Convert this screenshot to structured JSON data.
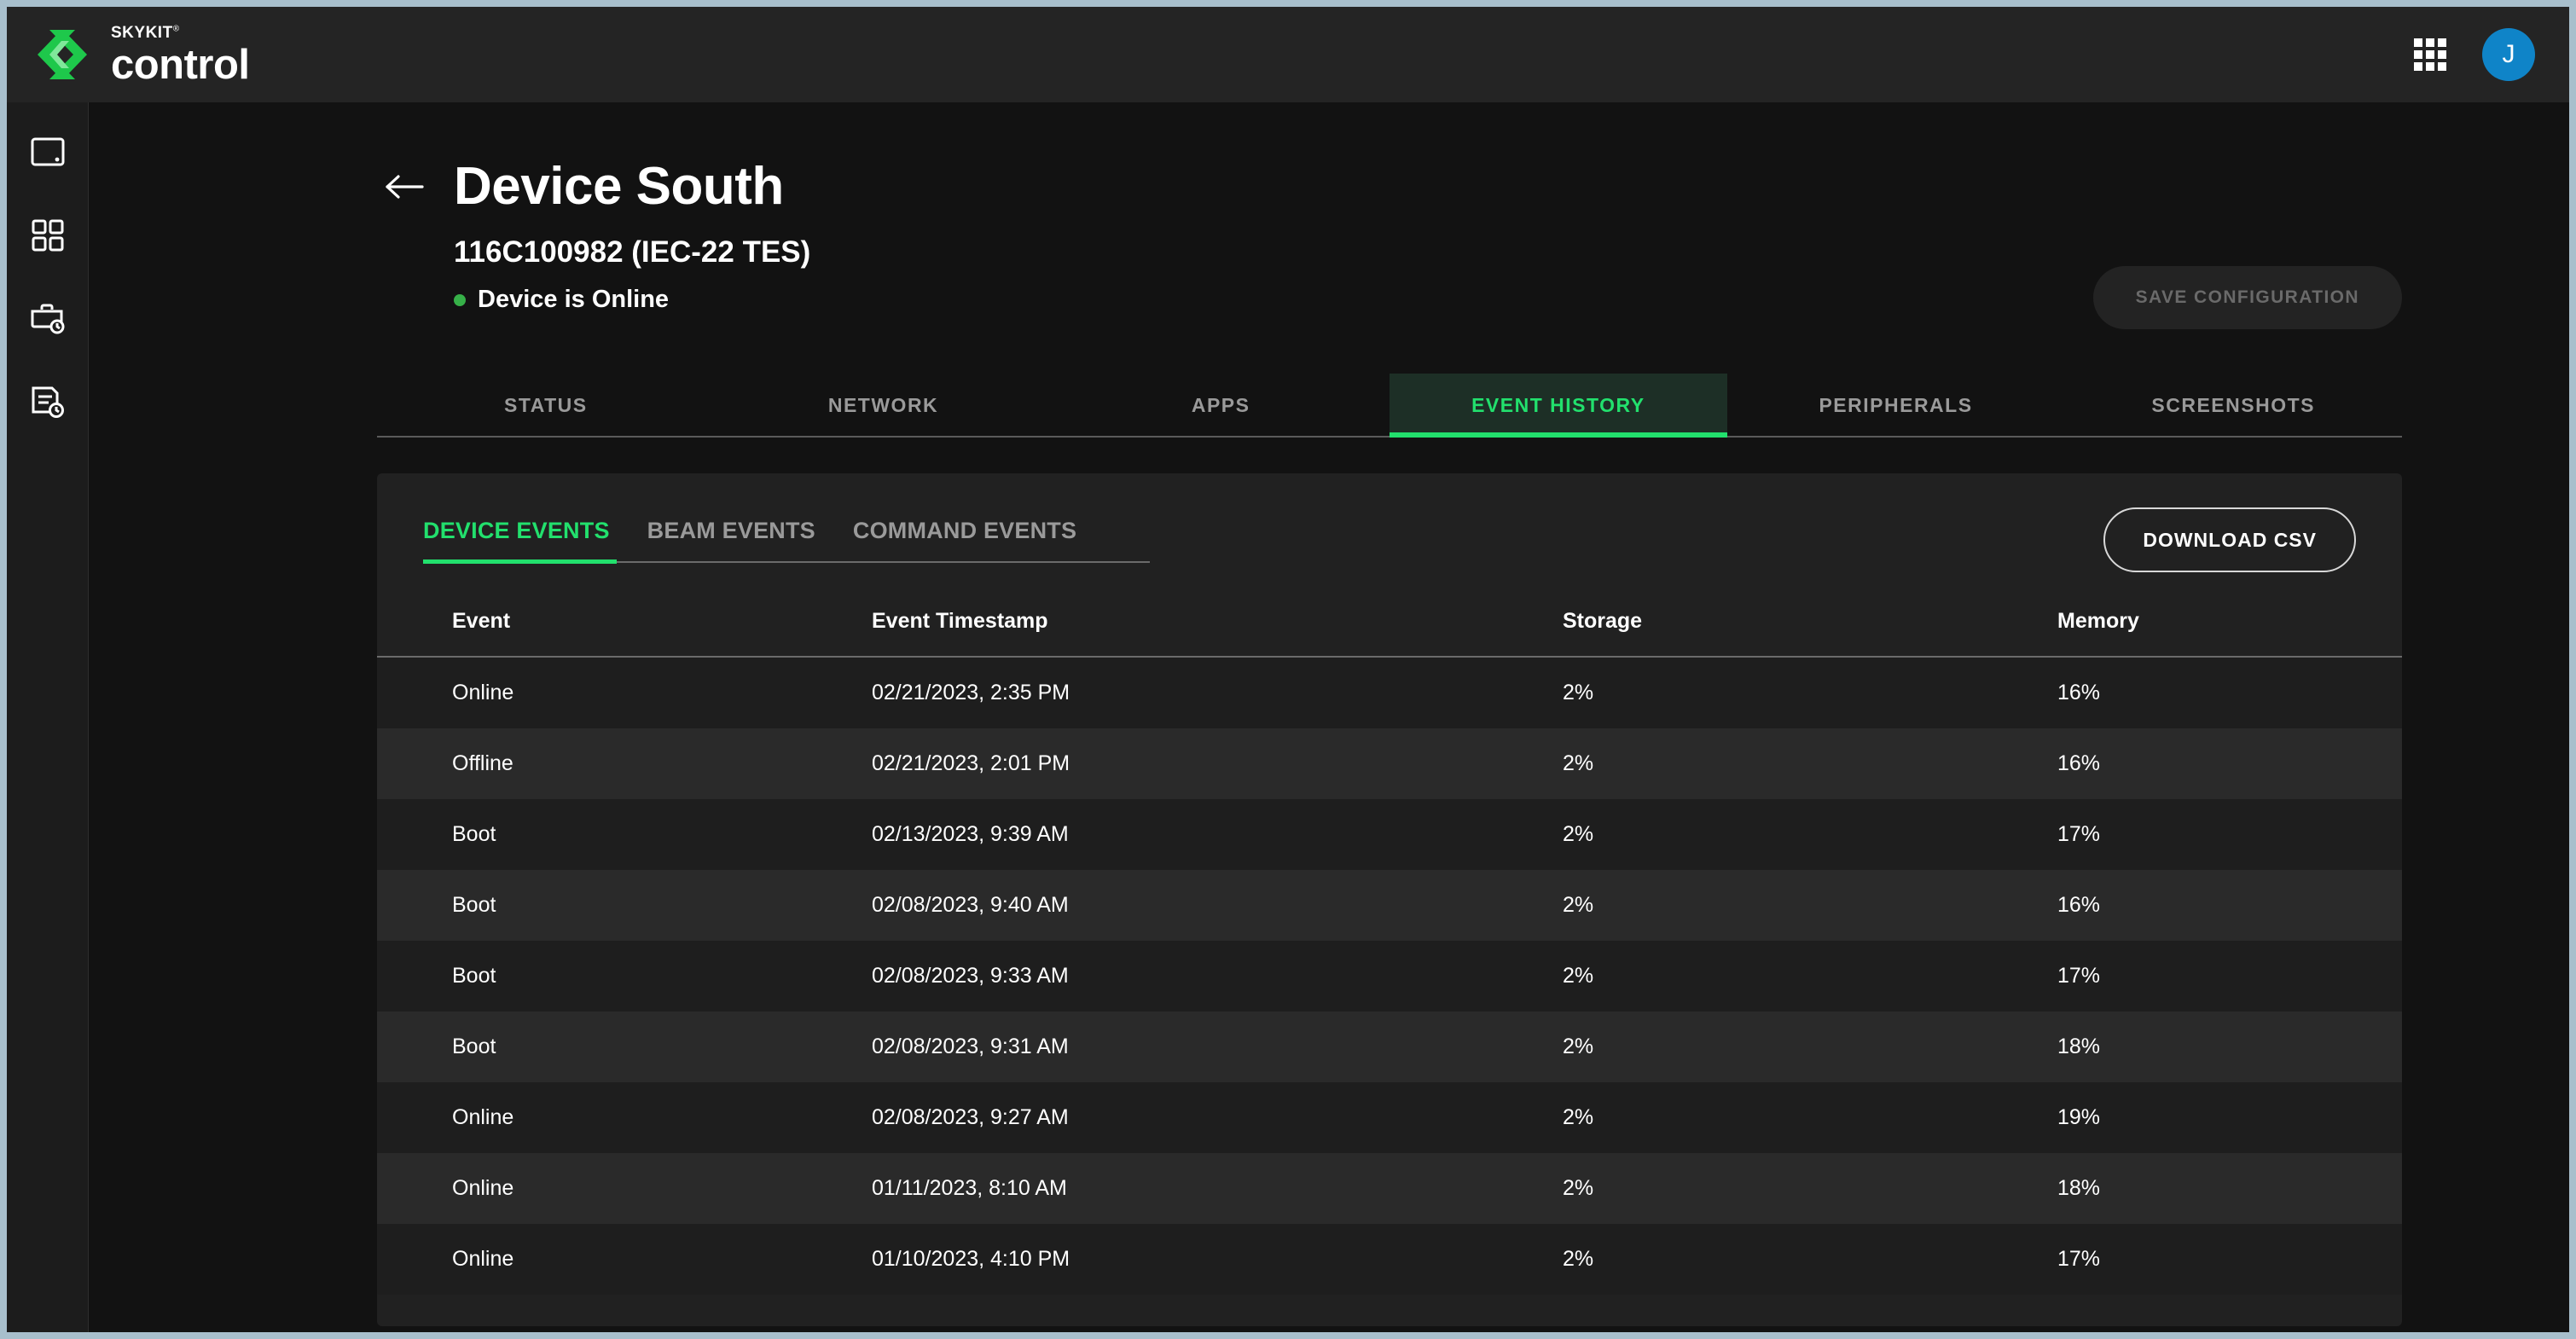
{
  "topbar": {
    "brand_name": "SKYKIT",
    "brand_mark": "®",
    "product": "control",
    "apps_icon": "apps-grid-icon",
    "avatar_initial": "J"
  },
  "sidebar": {
    "items": [
      {
        "icon": "display-screen-icon",
        "label": "Displays"
      },
      {
        "icon": "apps-grid-icon",
        "label": "Apps"
      },
      {
        "icon": "briefcase-clock-icon",
        "label": "Jobs"
      },
      {
        "icon": "document-clock-icon",
        "label": "Reports"
      }
    ]
  },
  "page": {
    "back_icon": "back-arrow-icon",
    "title": "Device South",
    "serial": "116C100982 (IEC-22 TES)",
    "status_text": "Device is Online",
    "status_color": "#36b048",
    "save_button": "SAVE CONFIGURATION"
  },
  "main_tabs": [
    {
      "label": "STATUS",
      "active": false
    },
    {
      "label": "NETWORK",
      "active": false
    },
    {
      "label": "APPS",
      "active": false
    },
    {
      "label": "EVENT HISTORY",
      "active": true
    },
    {
      "label": "PERIPHERALS",
      "active": false
    },
    {
      "label": "SCREENSHOTS",
      "active": false
    }
  ],
  "sub_tabs": [
    {
      "label": "DEVICE EVENTS",
      "active": true
    },
    {
      "label": "BEAM EVENTS",
      "active": false
    },
    {
      "label": "COMMAND EVENTS",
      "active": false
    }
  ],
  "download_button": "DOWNLOAD CSV",
  "table": {
    "columns": [
      "Event",
      "Event Timestamp",
      "Storage",
      "Memory"
    ],
    "rows": [
      {
        "event": "Online",
        "timestamp": "02/21/2023, 2:35 PM",
        "storage": "2%",
        "memory": "16%"
      },
      {
        "event": "Offline",
        "timestamp": "02/21/2023, 2:01 PM",
        "storage": "2%",
        "memory": "16%"
      },
      {
        "event": "Boot",
        "timestamp": "02/13/2023, 9:39 AM",
        "storage": "2%",
        "memory": "17%"
      },
      {
        "event": "Boot",
        "timestamp": "02/08/2023, 9:40 AM",
        "storage": "2%",
        "memory": "16%"
      },
      {
        "event": "Boot",
        "timestamp": "02/08/2023, 9:33 AM",
        "storage": "2%",
        "memory": "17%"
      },
      {
        "event": "Boot",
        "timestamp": "02/08/2023, 9:31 AM",
        "storage": "2%",
        "memory": "18%"
      },
      {
        "event": "Online",
        "timestamp": "02/08/2023, 9:27 AM",
        "storage": "2%",
        "memory": "19%"
      },
      {
        "event": "Online",
        "timestamp": "01/11/2023, 8:10 AM",
        "storage": "2%",
        "memory": "18%"
      },
      {
        "event": "Online",
        "timestamp": "01/10/2023, 4:10 PM",
        "storage": "2%",
        "memory": "17%"
      }
    ]
  },
  "colors": {
    "accent_green": "#22e06d",
    "avatar_blue": "#0f84c8",
    "page_bg": "#121212",
    "card_bg": "#212121",
    "topbar_bg": "#242424"
  }
}
